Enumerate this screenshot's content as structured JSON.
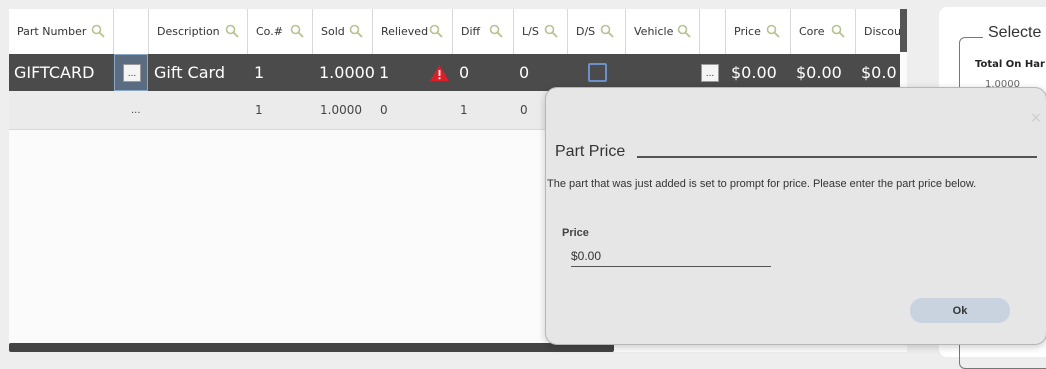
{
  "grid": {
    "columns": [
      {
        "label": "Part Number"
      },
      {
        "label": ""
      },
      {
        "label": "Description"
      },
      {
        "label": "Co.#"
      },
      {
        "label": "Sold"
      },
      {
        "label": "Relieved"
      },
      {
        "label": "Diff"
      },
      {
        "label": "L/S"
      },
      {
        "label": "D/S"
      },
      {
        "label": "Vehicle"
      },
      {
        "label": ""
      },
      {
        "label": "Price"
      },
      {
        "label": "Core"
      },
      {
        "label": "Discou"
      }
    ],
    "row1": {
      "part_number": "GIFTCARD",
      "ellipsis": "...",
      "description": "Gift Card",
      "co": "1",
      "sold": "1.0000",
      "relieved": "1",
      "diff": "0",
      "ls": "0",
      "vehicle_btn": "...",
      "price": "$0.00",
      "core": "$0.00",
      "discount": "$0.0"
    },
    "row2": {
      "ellipsis": "...",
      "co": "1",
      "sold": "1.0000",
      "relieved": "0",
      "diff": "1",
      "ls": "0"
    },
    "colors": {
      "selected_row": "#4b4b4b",
      "warning": "#d9202a",
      "checkbox": "#6e8fc9"
    }
  },
  "right_panel": {
    "legend": "Selecte",
    "total_on_hand_label": "Total On Har",
    "total_on_hand_value": "1.0000"
  },
  "dialog": {
    "title": "Part Price",
    "message": "The part that was just added is set to prompt for price. Please enter the part price below.",
    "price_label": "Price",
    "price_value": "$0.00",
    "ok_label": "Ok",
    "close_symbol": "×"
  }
}
